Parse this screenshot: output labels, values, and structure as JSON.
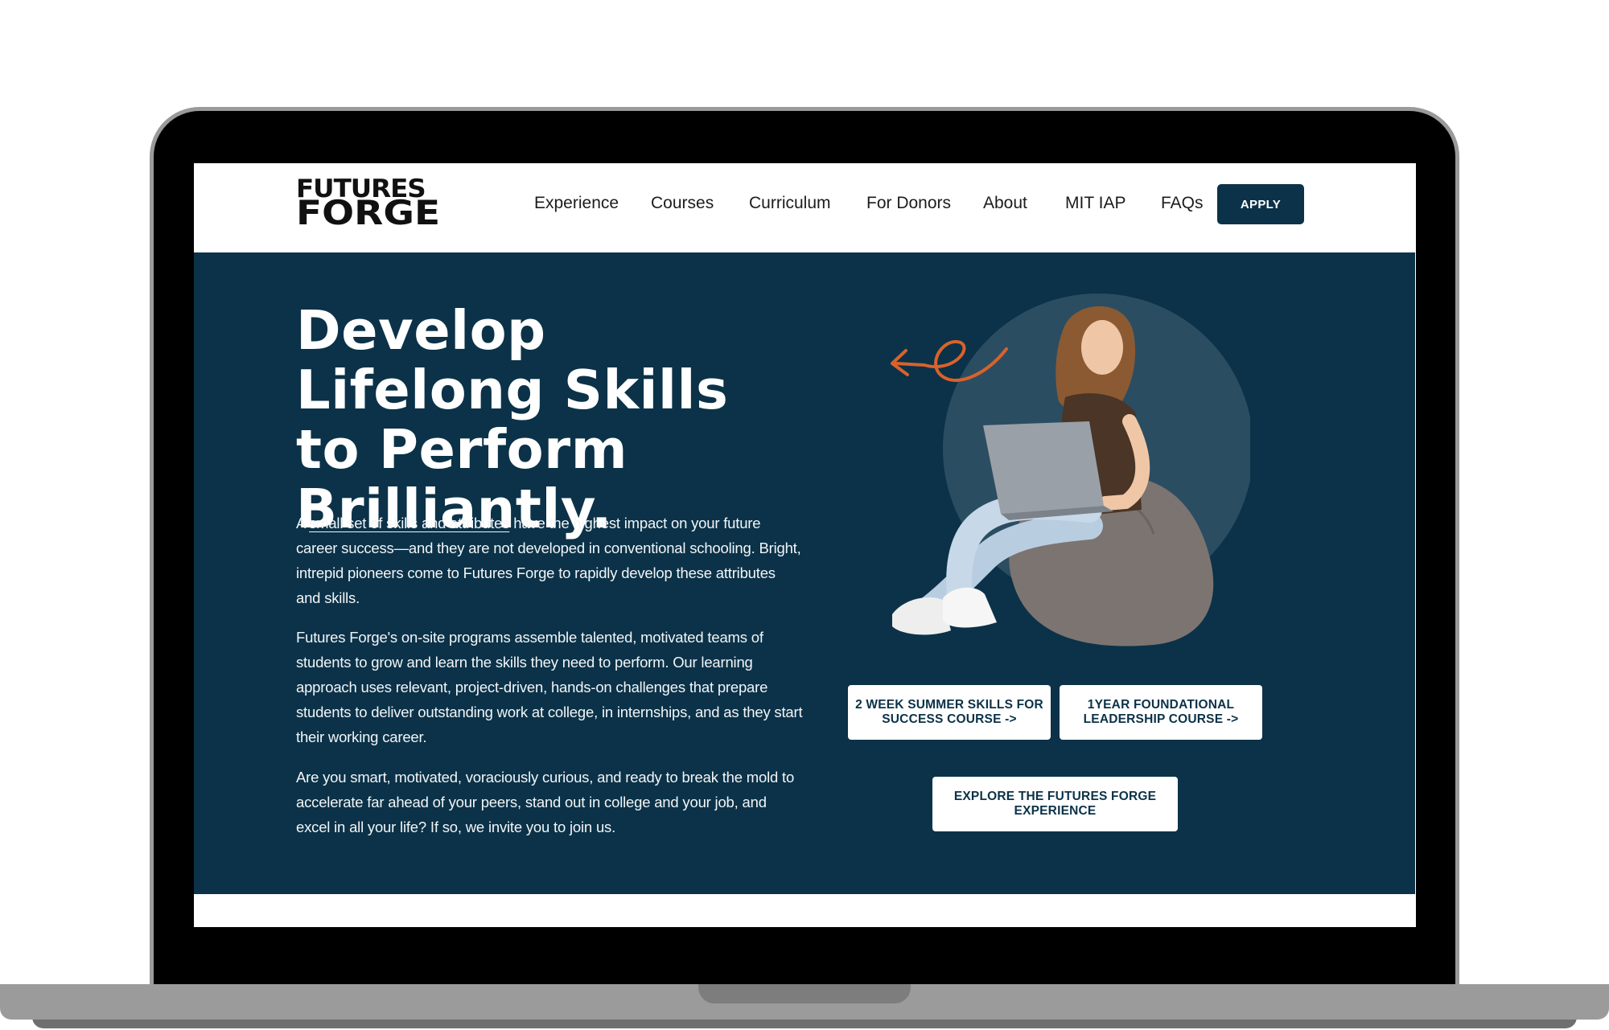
{
  "header": {
    "logo_line1": "FUTURES",
    "logo_line2": "FORGE",
    "nav": [
      "Experience",
      "Courses",
      "Curriculum",
      "For Donors",
      "About",
      "MIT IAP",
      "FAQs"
    ],
    "apply_label": "APPLY"
  },
  "hero": {
    "title": "Develop Lifelong Skills to Perform Brilliantly.",
    "p1_prefix": "A ",
    "p1_link": "small set of skills and attributes",
    "p1_rest": " have the highest impact on your future career success—and they are not developed in conventional schooling. Bright, intrepid pioneers come to Futures Forge to rapidly develop these attributes and skills.",
    "p2": "Futures Forge's on-site programs assemble talented, motivated teams of students to grow and learn the skills they need to perform. Our learning approach uses relevant, project-driven, hands-on challenges that prepare students to deliver outstanding work at college, in internships, and as they start their working career.",
    "p3": "Are you smart, motivated, voraciously curious, and ready to break the mold to accelerate far ahead of your peers, stand out in college and your job, and excel in all your life? If so, we invite you to join us.",
    "cta_summer": "2 WEEK SUMMER SKILLS FOR SUCCESS COURSE ->",
    "cta_year": "1YEAR FOUNDATIONAL LEADERSHIP COURSE ->",
    "cta_explore": "EXPLORE THE FUTURES FORGE EXPERIENCE"
  },
  "colors": {
    "brand_navy": "#0b3248",
    "accent_orange": "#d9622b",
    "circle": "#2b4d61",
    "beanbag": "#7c7471"
  }
}
